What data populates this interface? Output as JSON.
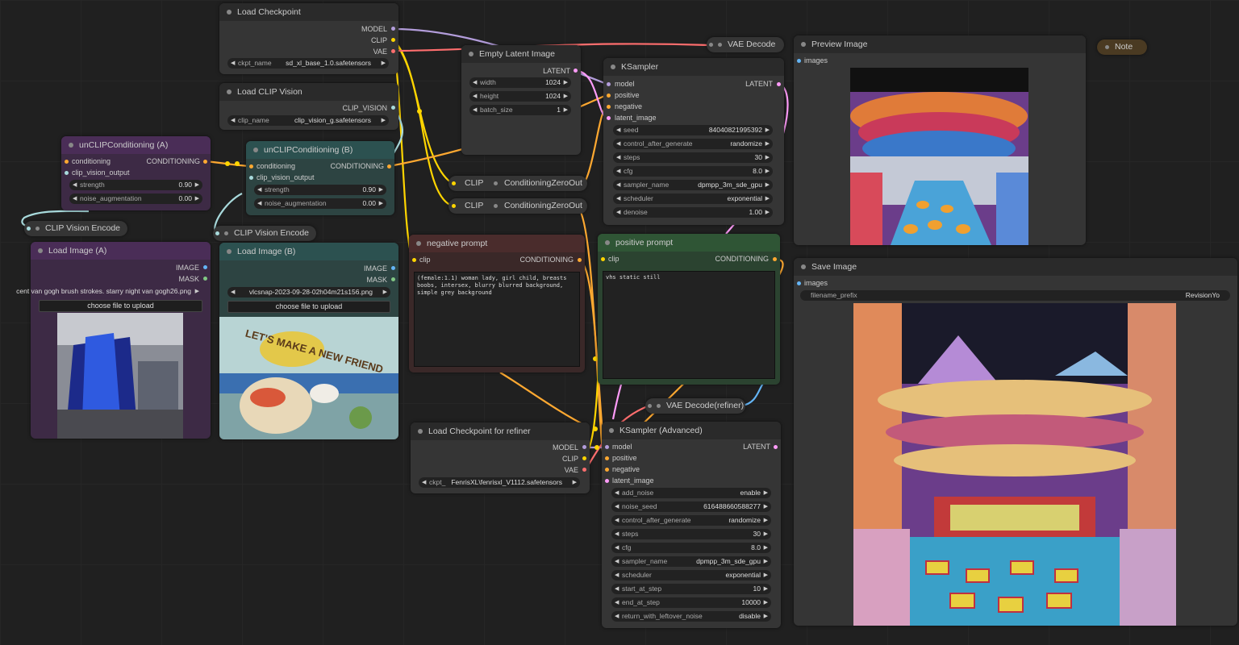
{
  "colors": {
    "canvas": "#202020",
    "model": "#b39ddb",
    "clip": "#ffd500",
    "vae": "#ff6e6e",
    "conditioning": "#ffa931",
    "latent": "#ff9cf9",
    "image": "#64b5f6",
    "clip_vision": "#a8dadc",
    "mask": "#81c784"
  },
  "load_checkpoint": {
    "title": "Load Checkpoint",
    "out_model": "MODEL",
    "out_clip": "CLIP",
    "out_vae": "VAE",
    "ckpt_label": "ckpt_name",
    "ckpt_value": "sd_xl_base_1.0.safetensors"
  },
  "load_clip_vision": {
    "title": "Load CLIP Vision",
    "out": "CLIP_VISION",
    "clip_label": "clip_name",
    "clip_value": "clip_vision_g.safetensors"
  },
  "empty_latent": {
    "title": "Empty Latent Image",
    "out": "LATENT",
    "width_label": "width",
    "width_value": "1024",
    "height_label": "height",
    "height_value": "1024",
    "batch_label": "batch_size",
    "batch_value": "1"
  },
  "vae_decode": {
    "title": "VAE Decode"
  },
  "ksampler": {
    "title": "KSampler",
    "in_model": "model",
    "in_positive": "positive",
    "in_negative": "negative",
    "in_latent": "latent_image",
    "out": "LATENT",
    "widgets": [
      {
        "label": "seed",
        "value": "84040821995392"
      },
      {
        "label": "control_after_generate",
        "value": "randomize"
      },
      {
        "label": "steps",
        "value": "30"
      },
      {
        "label": "cfg",
        "value": "8.0"
      },
      {
        "label": "sampler_name",
        "value": "dpmpp_3m_sde_gpu"
      },
      {
        "label": "scheduler",
        "value": "exponential"
      },
      {
        "label": "denoise",
        "value": "1.00"
      }
    ]
  },
  "preview_image": {
    "title": "Preview Image",
    "in": "images"
  },
  "note": {
    "title": "Note"
  },
  "unclip_a": {
    "title": "unCLIPConditioning (A)",
    "in_cond": "conditioning",
    "in_cv": "clip_vision_output",
    "out": "CONDITIONING",
    "strength_label": "strength",
    "strength_value": "0.90",
    "noise_label": "noise_augmentation",
    "noise_value": "0.00"
  },
  "unclip_b": {
    "title": "unCLIPConditioning (B)",
    "in_cond": "conditioning",
    "in_cv": "clip_vision_output",
    "out": "CONDITIONING",
    "strength_label": "strength",
    "strength_value": "0.90",
    "noise_label": "noise_augmentation",
    "noise_value": "0.00"
  },
  "czo1": {
    "clip": "CLIP",
    "title": "ConditioningZeroOut"
  },
  "czo2": {
    "clip": "CLIP",
    "title": "ConditioningZeroOut"
  },
  "clip_vision_encode_a": {
    "title": "CLIP Vision Encode"
  },
  "clip_vision_encode_b": {
    "title": "CLIP Vision Encode"
  },
  "load_image_a": {
    "title": "Load Image (A)",
    "out_image": "IMAGE",
    "out_mask": "MASK",
    "image_value": "cent van gogh brush strokes. starry night van gogh26.png",
    "upload": "choose file to upload"
  },
  "load_image_b": {
    "title": "Load Image (B)",
    "out_image": "IMAGE",
    "out_mask": "MASK",
    "image_value": "vlcsnap-2023-09-28-02h04m21s156.png",
    "upload": "choose file to upload",
    "picture_text": "LET'S MAKE A NEW FRIEND"
  },
  "negative_prompt": {
    "title": "negative prompt",
    "in": "clip",
    "out": "CONDITIONING",
    "text": "(female:1.1) woman lady, girl child, breasts boobs, intersex, blurry blurred background, simple grey background"
  },
  "positive_prompt": {
    "title": "positive prompt",
    "in": "clip",
    "out": "CONDITIONING",
    "text": "vhs static still"
  },
  "save_image": {
    "title": "Save Image",
    "in": "images",
    "prefix_label": "filename_prefix",
    "prefix_value": "RevisionYo"
  },
  "vae_decode_refiner": {
    "title": "VAE Decode(refiner)"
  },
  "load_checkpoint_refiner": {
    "title": "Load Checkpoint for refiner",
    "out_model": "MODEL",
    "out_clip": "CLIP",
    "out_vae": "VAE",
    "ckpt_label": "ckpt_",
    "ckpt_value": "FenrisXL\\fenrisxl_V1112.safetensors"
  },
  "ksampler_adv": {
    "title": "KSampler (Advanced)",
    "in_model": "model",
    "in_positive": "positive",
    "in_negative": "negative",
    "in_latent": "latent_image",
    "out": "LATENT",
    "widgets": [
      {
        "label": "add_noise",
        "value": "enable"
      },
      {
        "label": "noise_seed",
        "value": "616488660588277"
      },
      {
        "label": "control_after_generate",
        "value": "randomize"
      },
      {
        "label": "steps",
        "value": "30"
      },
      {
        "label": "cfg",
        "value": "8.0"
      },
      {
        "label": "sampler_name",
        "value": "dpmpp_3m_sde_gpu"
      },
      {
        "label": "scheduler",
        "value": "exponential"
      },
      {
        "label": "start_at_step",
        "value": "10"
      },
      {
        "label": "end_at_step",
        "value": "10000"
      },
      {
        "label": "return_with_leftover_noise",
        "value": "disable"
      }
    ]
  }
}
